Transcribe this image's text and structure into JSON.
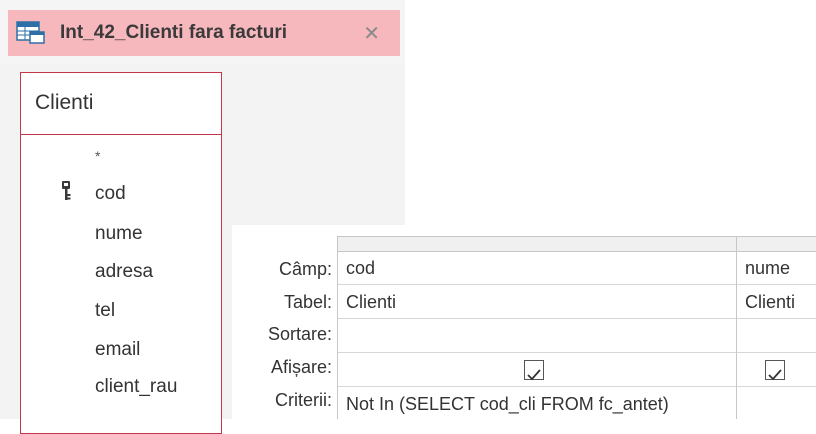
{
  "tab": {
    "title": "Int_42_Clienti fara facturi",
    "icon": "query-icon",
    "close_glyph": "✕"
  },
  "table": {
    "name": "Clienti",
    "fields": [
      "*",
      "cod",
      "nume",
      "adresa",
      "tel",
      "email",
      "client_rau"
    ],
    "primary_key": "cod"
  },
  "grid": {
    "row_labels": {
      "field": "Câmp:",
      "table": "Tabel:",
      "sort": "Sortare:",
      "show": "Afișare:",
      "criteria": "Criterii:"
    },
    "columns": [
      {
        "field": "cod",
        "table": "Clienti",
        "sort": "",
        "show": true,
        "criteria": "Not In (SELECT cod_cli FROM fc_antet)"
      },
      {
        "field": "nume",
        "table": "Clienti",
        "sort": "",
        "show": true,
        "criteria": ""
      }
    ]
  },
  "colors": {
    "tab_background": "#f6b8bd",
    "table_border": "#c2384a"
  }
}
